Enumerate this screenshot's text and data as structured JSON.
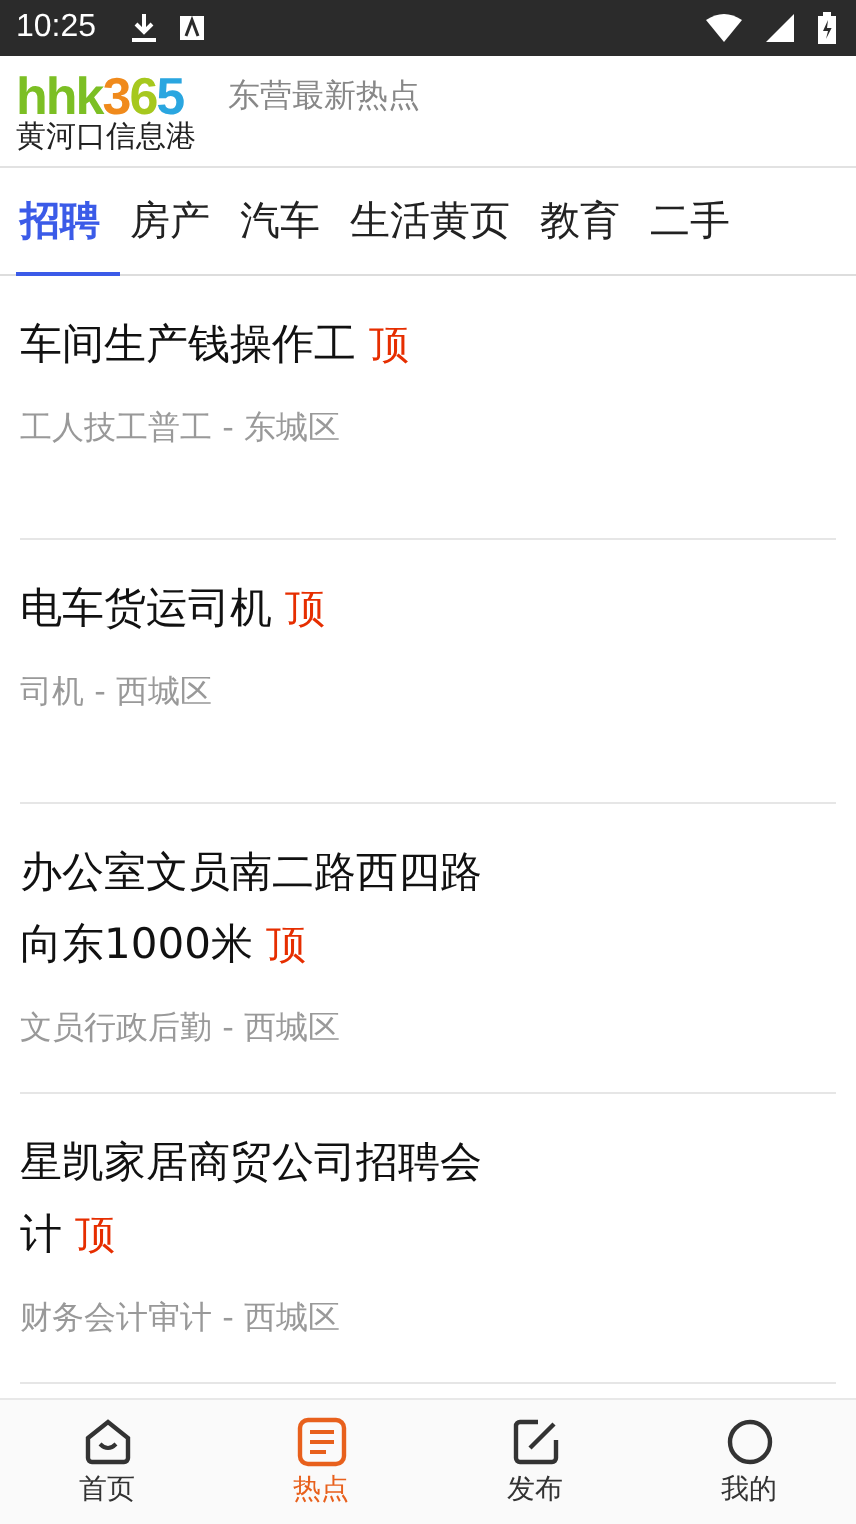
{
  "status_bar": {
    "time": "10:25"
  },
  "header": {
    "logo": {
      "letters": "hhk",
      "digits": [
        {
          "text": "3",
          "color": "#f08a1c"
        },
        {
          "text": "6",
          "color": "#a6c81e"
        },
        {
          "text": "5",
          "color": "#2aa6e0"
        }
      ],
      "name": "黄河口信息港"
    },
    "tagline": "东营最新热点"
  },
  "tabs": [
    {
      "label": "招聘",
      "selected": true
    },
    {
      "label": "房产",
      "selected": false
    },
    {
      "label": "汽车",
      "selected": false
    },
    {
      "label": "生活黄页",
      "selected": false
    },
    {
      "label": "教育",
      "selected": false
    },
    {
      "label": "二手",
      "selected": false
    }
  ],
  "listings": [
    {
      "title": "车间生产钱操作工",
      "badge": "顶",
      "meta": "工人技工普工 - 东城区"
    },
    {
      "title": "电车货运司机",
      "badge": "顶",
      "meta": "司机 - 西城区"
    },
    {
      "title": "办公室文员南二路西四路向东1000米",
      "badge": "顶",
      "meta": "文员行政后勤 - 西城区"
    },
    {
      "title": "星凯家居商贸公司招聘会计",
      "badge": "顶",
      "meta": "财务会计审计 - 西城区"
    }
  ],
  "bottom_nav": [
    {
      "kind": "home",
      "label": "首页",
      "selected": false
    },
    {
      "kind": "hot",
      "label": "热点",
      "selected": true
    },
    {
      "kind": "post",
      "label": "发布",
      "selected": false
    },
    {
      "kind": "me",
      "label": "我的",
      "selected": false
    }
  ]
}
